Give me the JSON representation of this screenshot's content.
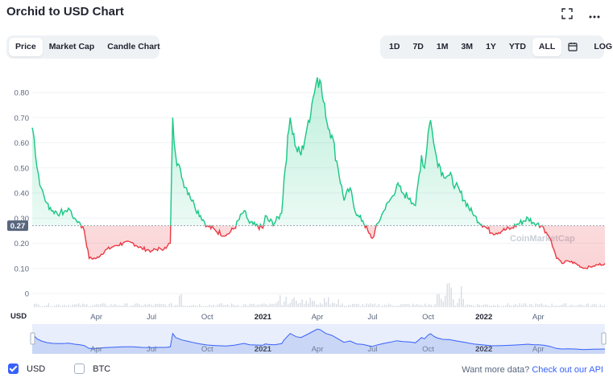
{
  "title": "Orchid to USD Chart",
  "icons": {
    "fullscreen": "fullscreen-icon",
    "more": "more-icon",
    "calendar": "calendar-icon"
  },
  "view_tabs": [
    "Price",
    "Market Cap",
    "Candle Chart"
  ],
  "active_view": "Price",
  "ranges": [
    "1D",
    "7D",
    "1M",
    "3M",
    "1Y",
    "YTD",
    "ALL"
  ],
  "active_range": "ALL",
  "log_label": "LOG",
  "currency_label": "USD",
  "current_price_label": "0.27",
  "watermark": "CoinMarketCap",
  "footer": {
    "options": [
      {
        "label": "USD",
        "checked": true
      },
      {
        "label": "BTC",
        "checked": false
      }
    ],
    "api_text": "Want more data?",
    "api_link": "Check out our API"
  },
  "colors": {
    "up": "#16c784",
    "down": "#ea3943",
    "accent": "#3861fb"
  },
  "chart_data": {
    "type": "area",
    "title": "Orchid to USD Chart",
    "ylabel": "USD",
    "ylim": [
      0,
      0.9
    ],
    "yticks": [
      0,
      0.1,
      0.2,
      0.3,
      0.4,
      0.5,
      0.6,
      0.7,
      0.8
    ],
    "ytick_labels": [
      "0",
      "0.10",
      "0.20",
      "0.30",
      "0.40",
      "0.50",
      "0.60",
      "0.70",
      "0.80"
    ],
    "baseline": 0.27,
    "xlim": [
      "2019-12-17",
      "2022-07-20"
    ],
    "xticks": [
      {
        "date": "2020-04-01",
        "label": "Apr"
      },
      {
        "date": "2020-07-01",
        "label": "Jul"
      },
      {
        "date": "2020-10-01",
        "label": "Oct"
      },
      {
        "date": "2021-01-01",
        "label": "2021"
      },
      {
        "date": "2021-04-01",
        "label": "Apr"
      },
      {
        "date": "2021-07-01",
        "label": "Jul"
      },
      {
        "date": "2021-10-01",
        "label": "Oct"
      },
      {
        "date": "2022-01-01",
        "label": "2022"
      },
      {
        "date": "2022-04-01",
        "label": "Apr"
      }
    ],
    "series": [
      {
        "x": [
          "2019-12-17",
          "2019-12-20",
          "2019-12-25",
          "2020-01-01",
          "2020-01-10",
          "2020-01-20",
          "2020-02-01",
          "2020-02-10",
          "2020-02-15",
          "2020-02-25",
          "2020-03-05",
          "2020-03-12",
          "2020-03-20",
          "2020-04-01",
          "2020-04-15",
          "2020-05-01",
          "2020-05-15",
          "2020-06-01",
          "2020-06-15",
          "2020-07-01",
          "2020-07-15",
          "2020-07-25",
          "2020-08-01",
          "2020-08-05",
          "2020-08-10",
          "2020-08-20",
          "2020-09-01",
          "2020-09-10",
          "2020-09-20",
          "2020-10-01",
          "2020-10-15",
          "2020-11-01",
          "2020-11-15",
          "2020-12-01",
          "2020-12-10",
          "2020-12-20",
          "2021-01-01",
          "2021-01-05",
          "2021-01-10",
          "2021-01-20",
          "2021-02-01",
          "2021-02-05",
          "2021-02-15",
          "2021-02-25",
          "2021-03-05",
          "2021-03-15",
          "2021-03-25",
          "2021-04-01",
          "2021-04-05",
          "2021-04-15",
          "2021-04-25",
          "2021-05-05",
          "2021-05-15",
          "2021-05-25",
          "2021-06-05",
          "2021-06-15",
          "2021-06-25",
          "2021-07-01",
          "2021-07-10",
          "2021-07-20",
          "2021-08-01",
          "2021-08-10",
          "2021-08-20",
          "2021-09-01",
          "2021-09-10",
          "2021-09-20",
          "2021-09-25",
          "2021-10-01",
          "2021-10-05",
          "2021-10-10",
          "2021-10-15",
          "2021-10-25",
          "2021-11-05",
          "2021-11-15",
          "2021-12-01",
          "2021-12-15",
          "2022-01-01",
          "2022-01-15",
          "2022-02-01",
          "2022-02-15",
          "2022-03-01",
          "2022-03-15",
          "2022-03-25",
          "2022-04-01",
          "2022-04-10",
          "2022-04-20",
          "2022-05-01",
          "2022-05-10",
          "2022-05-20",
          "2022-06-01",
          "2022-06-15",
          "2022-07-01",
          "2022-07-20"
        ],
        "y": [
          0.66,
          0.62,
          0.5,
          0.42,
          0.36,
          0.33,
          0.32,
          0.33,
          0.34,
          0.3,
          0.28,
          0.25,
          0.14,
          0.14,
          0.17,
          0.19,
          0.2,
          0.2,
          0.18,
          0.17,
          0.18,
          0.18,
          0.2,
          0.7,
          0.55,
          0.46,
          0.4,
          0.35,
          0.31,
          0.27,
          0.25,
          0.23,
          0.26,
          0.33,
          0.28,
          0.27,
          0.26,
          0.31,
          0.29,
          0.28,
          0.32,
          0.46,
          0.7,
          0.58,
          0.55,
          0.66,
          0.78,
          0.86,
          0.85,
          0.7,
          0.63,
          0.5,
          0.37,
          0.42,
          0.31,
          0.29,
          0.24,
          0.22,
          0.28,
          0.33,
          0.38,
          0.43,
          0.4,
          0.38,
          0.35,
          0.55,
          0.5,
          0.64,
          0.69,
          0.6,
          0.54,
          0.48,
          0.47,
          0.43,
          0.37,
          0.31,
          0.27,
          0.24,
          0.25,
          0.26,
          0.28,
          0.3,
          0.28,
          0.28,
          0.26,
          0.22,
          0.14,
          0.12,
          0.13,
          0.12,
          0.1,
          0.11,
          0.12
        ]
      }
    ]
  }
}
